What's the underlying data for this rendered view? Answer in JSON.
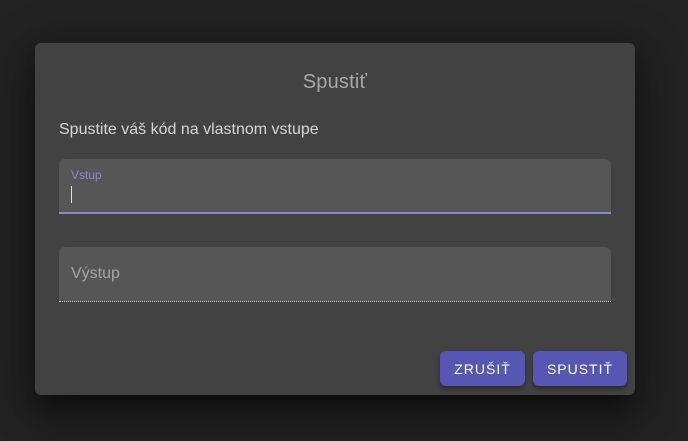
{
  "dialog": {
    "title": "Spustiť",
    "subtitle": "Spustite váš kód na vlastnom vstupe",
    "input_field": {
      "label": "Vstup",
      "value": ""
    },
    "output_field": {
      "label": "Výstup",
      "value": ""
    },
    "buttons": {
      "cancel_label": "ZRUŠIŤ",
      "run_label": "SPUSTIŤ"
    }
  },
  "colors": {
    "accent": "#5557b3",
    "focus_label": "#8d87cf",
    "dialog_bg": "#424242",
    "backdrop": "#232323"
  }
}
